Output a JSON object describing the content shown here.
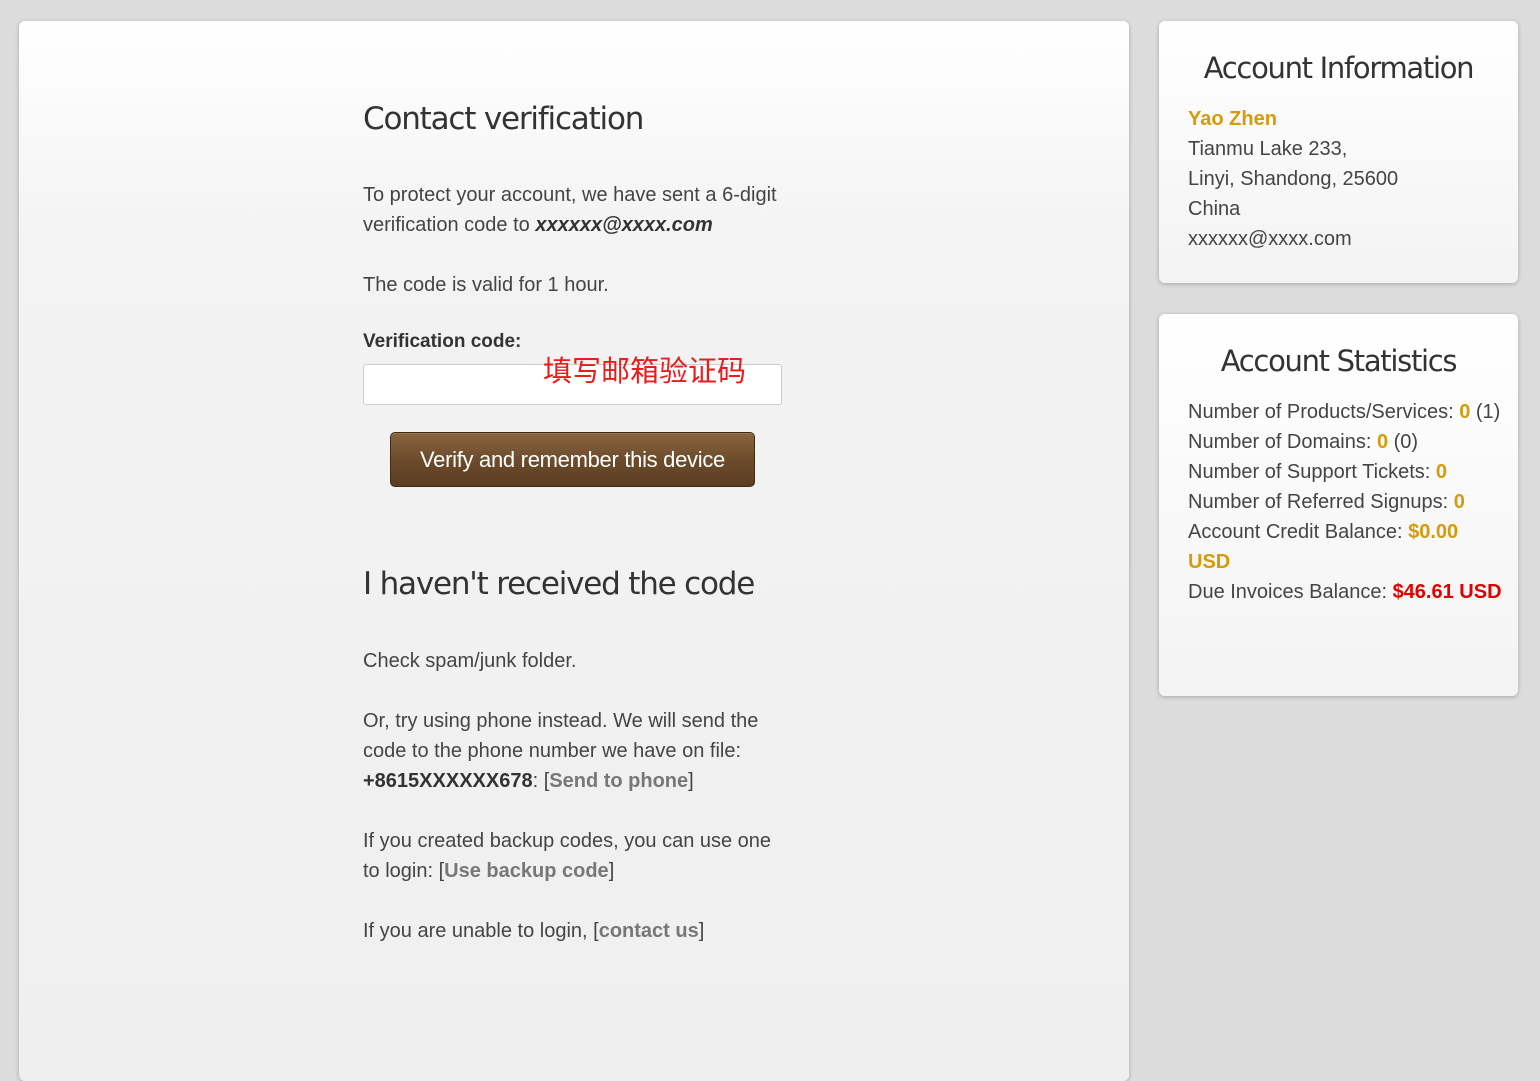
{
  "verification": {
    "title": "Contact verification",
    "intro": "To protect your account, we have sent a 6-digit verification code to",
    "email": "xxxxxx@xxxx.com",
    "validity": "The code is valid for 1 hour.",
    "code_label": "Verification code:",
    "code_value": "",
    "annotation": "填写邮箱验证码",
    "verify_button": "Verify and remember this device"
  },
  "no_code": {
    "title": "I haven't received the code",
    "spam": "Check spam/junk folder.",
    "phone_text": "Or, try using phone instead. We will send the code to the phone number we have on file:",
    "phone_number": "+8615XXXXXX678",
    "phone_sep": ": [",
    "send_phone_link": "Send to phone",
    "bracket_close": "]",
    "backup_text": "If you created backup codes, you can use one to login: [",
    "backup_link": "Use backup code",
    "unable_text": "If you are unable to login, [",
    "contact_link": "contact us"
  },
  "account_info": {
    "title": "Account Information",
    "name": "Yao Zhen",
    "address1": "Tianmu Lake 233,",
    "address2": "Linyi, Shandong, 25600",
    "country": "China",
    "email": "xxxxxx@xxxx.com"
  },
  "account_stats": {
    "title": "Account Statistics",
    "products_label": "Number of Products/Services: ",
    "products_value": "0",
    "products_total": " (1)",
    "domains_label": "Number of Domains: ",
    "domains_value": "0",
    "domains_total": " (0)",
    "tickets_label": "Number of Support Tickets: ",
    "tickets_value": "0",
    "referrals_label": "Number of Referred Signups: ",
    "referrals_value": "0",
    "credit_label": "Account Credit Balance: ",
    "credit_value": "$0.00 USD",
    "due_label": "Due Invoices Balance: ",
    "due_value": "$46.61 USD"
  },
  "colors": {
    "accent_gold": "#d49b0c",
    "due_red": "#e00000",
    "button_brown": "#6a4a2a",
    "annotation_red": "#e81d1d"
  }
}
